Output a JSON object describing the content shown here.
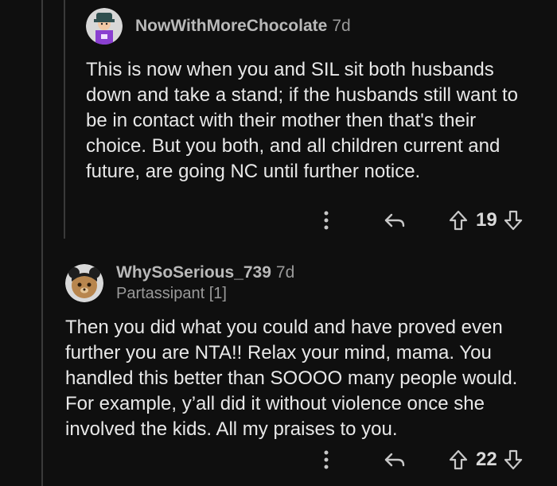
{
  "comments": [
    {
      "username": "NowWithMoreChocolate",
      "age": "7d",
      "body": "This is now when you and SIL sit both husbands down and take a stand; if the husbands still want to be in contact with their mother then that's their choice. But you both, and all children current and future, are going NC until further notice.",
      "score": "19",
      "avatar_icon": "avatar-purple-shirt-hat-icon"
    },
    {
      "username": "WhySoSerious_739",
      "age": "7d",
      "flair": "Partassipant [1]",
      "body": "Then you did what you could and have proved even further you are NTA!! Relax your mind, mama. You handled this better than SOOOO many people would. For example, y’all did it without violence once she involved the kids. All my praises to you.",
      "score": "22",
      "avatar_icon": "avatar-bear-buns-icon"
    }
  ],
  "colors": {
    "background": "#0f0f0f",
    "text": "#e8e8e8",
    "muted": "#9a9a9a",
    "thread_line": "#3a3a3a"
  }
}
